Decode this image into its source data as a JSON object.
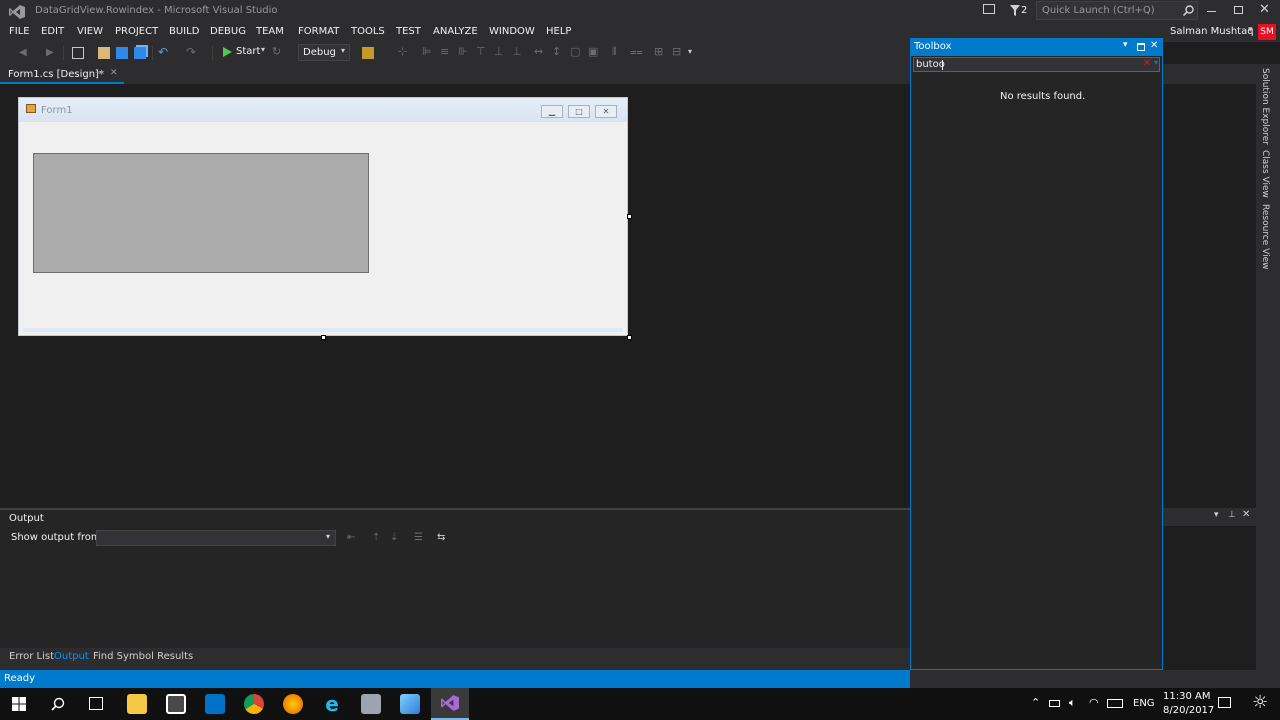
{
  "window": {
    "title": "DataGridView.Rowindex - Microsoft Visual Studio",
    "notification_count": "2",
    "quick_launch_placeholder": "Quick Launch (Ctrl+Q)",
    "user_name": "Salman Mushtaq",
    "user_initials": "SM"
  },
  "menu": {
    "items": [
      "FILE",
      "EDIT",
      "VIEW",
      "PROJECT",
      "BUILD",
      "DEBUG",
      "TEAM",
      "FORMAT",
      "TOOLS",
      "TEST",
      "ANALYZE",
      "WINDOW",
      "HELP"
    ]
  },
  "toolbar": {
    "start_label": "Start",
    "config_value": "Debug"
  },
  "document_tab": {
    "label": "Form1.cs [Design]*"
  },
  "form": {
    "title": "Form1"
  },
  "output": {
    "title": "Output",
    "show_from_label": "Show output from:",
    "show_from_value": ""
  },
  "bottom_tabs": [
    "Error List",
    "Output",
    "Find Symbol Results"
  ],
  "status": {
    "text": "Ready"
  },
  "toolbox": {
    "title": "Toolbox",
    "search_value": "butoo",
    "empty_message": "No results found."
  },
  "side_tabs": [
    "Solution Explorer",
    "Class View",
    "Resource View"
  ],
  "tray": {
    "language": "ENG",
    "time": "11:30 AM",
    "date": "8/20/2017"
  },
  "colors": {
    "accent": "#007acc",
    "chrome": "#2d2d30",
    "editor_bg": "#1e1e1e",
    "vs_purple": "#68217a"
  }
}
